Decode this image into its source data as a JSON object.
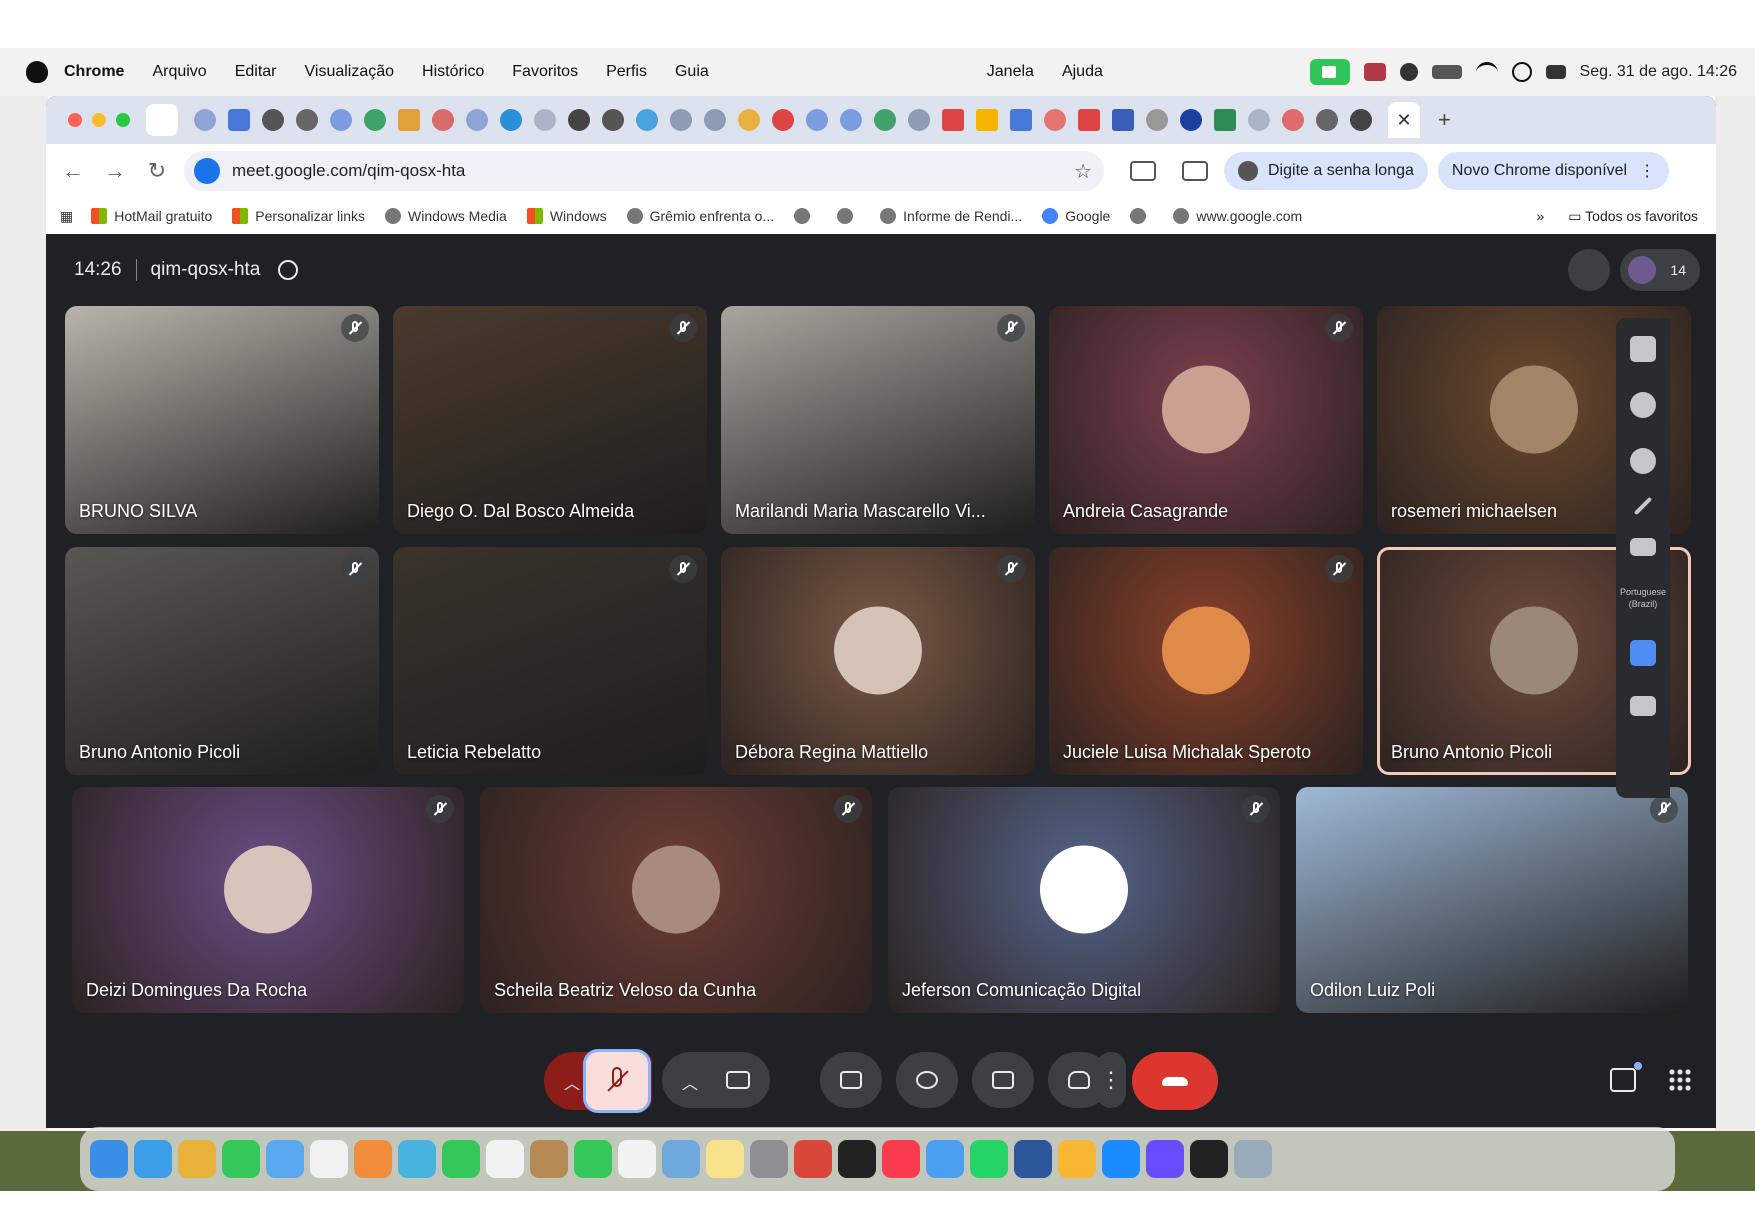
{
  "menubar": {
    "app": "Chrome",
    "items": [
      "Arquivo",
      "Editar",
      "Visualização",
      "Histórico",
      "Favoritos",
      "Perfis",
      "Guia"
    ],
    "items_right": [
      "Janela",
      "Ajuda"
    ],
    "clock": "Seg. 31 de ago.  14:26"
  },
  "browser": {
    "active_tab_close": "✕",
    "new_tab": "+",
    "url": "meet.google.com/qim-qosx-hta",
    "pill_password": "Digite a senha longa",
    "pill_update": "Novo Chrome disponível",
    "bookmarks": [
      "HotMail gratuito",
      "Personalizar links",
      "Windows Media",
      "Windows",
      "Grêmio enfrenta o...",
      "Informe de Rendi...",
      "Google",
      "www.google.com"
    ],
    "bookmarks_more": "»",
    "all_bookmarks": "Todos os favoritos"
  },
  "meet": {
    "time": "14:26",
    "code": "qim-qosx-hta",
    "participant_count": "14",
    "participants": [
      {
        "name": "BRUNO SILVA",
        "bg": "#b9b4ab",
        "muted": true
      },
      {
        "name": "Diego O. Dal Bosco Almeida",
        "bg": "#4b3a2d",
        "muted": true
      },
      {
        "name": "Marilandi Maria Mascarello Vi...",
        "bg": "#a9a59e",
        "muted": true
      },
      {
        "name": "Andreia Casagrande",
        "bg": "#7d3f4f",
        "muted": true,
        "avatar": "#caa090"
      },
      {
        "name": "rosemeri michaelsen",
        "bg": "#6b4a2e",
        "muted": false,
        "avatar": "#a38467"
      },
      {
        "name": "Bruno Antonio Picoli",
        "bg": "#5a5654",
        "muted": true
      },
      {
        "name": "Leticia Rebelatto",
        "bg": "#3b332c",
        "muted": true
      },
      {
        "name": "Débora Regina Mattiello",
        "bg": "#7a5a45",
        "muted": true,
        "avatar": "#d4c2b6"
      },
      {
        "name": "Juciele Luisa Michalak Speroto",
        "bg": "#8a4129",
        "muted": true,
        "avatar": "#e08a4a"
      },
      {
        "name": "Bruno Antonio Picoli",
        "bg": "#6e4b3b",
        "muted": false,
        "avatar": "#9c8878",
        "active": true
      },
      {
        "name": "Deizi Domingues Da Rocha",
        "bg": "#6b4e85",
        "muted": true,
        "avatar": "#d8c4bb"
      },
      {
        "name": "Scheila Beatriz Veloso da Cunha",
        "bg": "#6e3d35",
        "muted": true,
        "avatar": "#a88a7f"
      },
      {
        "name": "Jeferson Comunicação Digital",
        "bg": "#55658a",
        "muted": true,
        "avatar": "#ffffff"
      },
      {
        "name": "Odilon Luiz Poli",
        "bg": "#9fb9d6",
        "muted": true
      }
    ],
    "rail_caption_language": "Portuguese (Brazil)"
  },
  "colors": {
    "meet_bg": "#202124",
    "control_bg": "#3c4043",
    "end_call": "#dc362e",
    "mic_off_group": "#8c1d18"
  }
}
